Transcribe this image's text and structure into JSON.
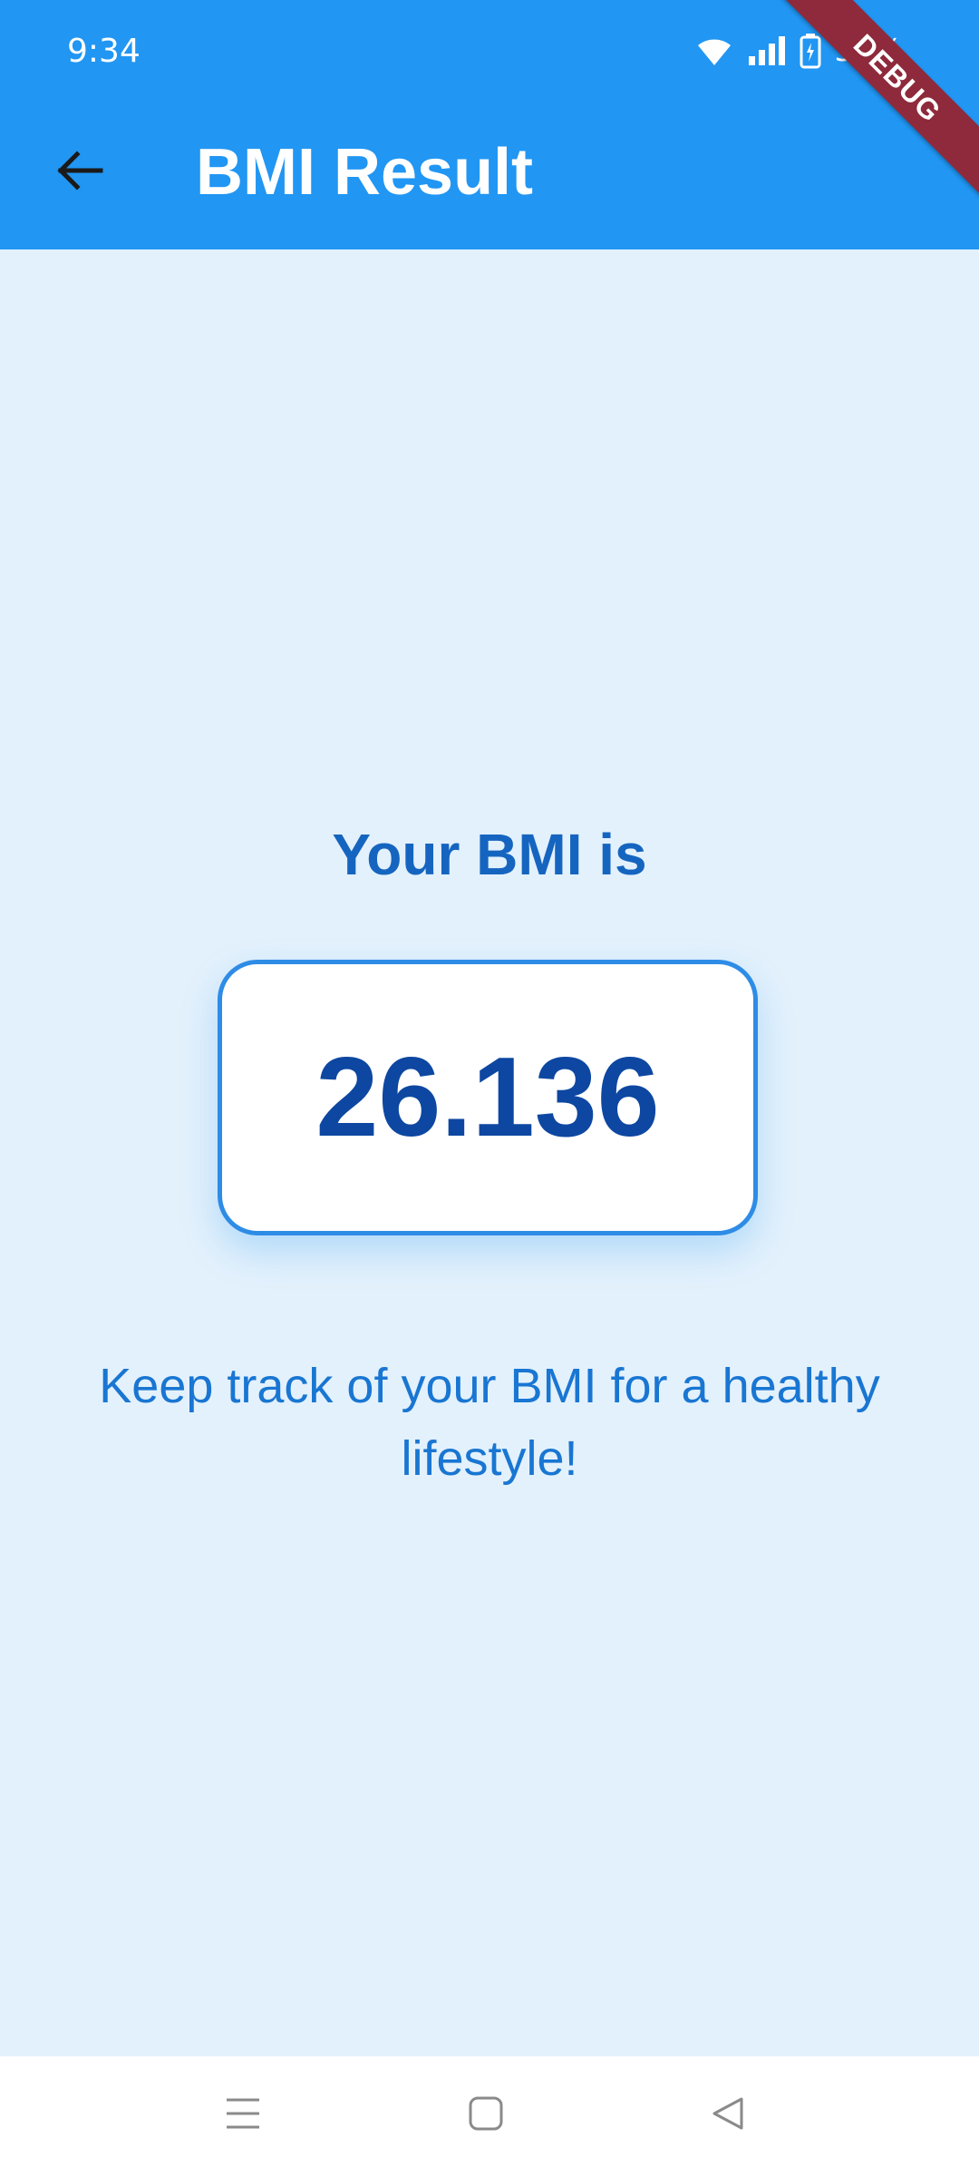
{
  "status_bar": {
    "time": "9:34",
    "battery_percent": "37%",
    "icons": [
      "wifi-icon",
      "signal-icon",
      "battery-charging-icon"
    ]
  },
  "app_bar": {
    "title": "BMI Result",
    "back_icon": "arrow-left-icon"
  },
  "debug_banner": "DEBUG",
  "result": {
    "heading": "Your BMI is",
    "value": "26.136",
    "tagline": "Keep track of your BMI for a healthy lifestyle!"
  },
  "nav_bar": {
    "buttons": [
      "menu-icon",
      "home-icon",
      "back-triangle-icon"
    ]
  },
  "colors": {
    "app_bar": "#2196F3",
    "background": "#E3F1FC",
    "heading": "#1565C0",
    "value": "#0D47A1",
    "card_border": "#2E8CE6",
    "debug_ribbon": "#8E2A3B"
  }
}
